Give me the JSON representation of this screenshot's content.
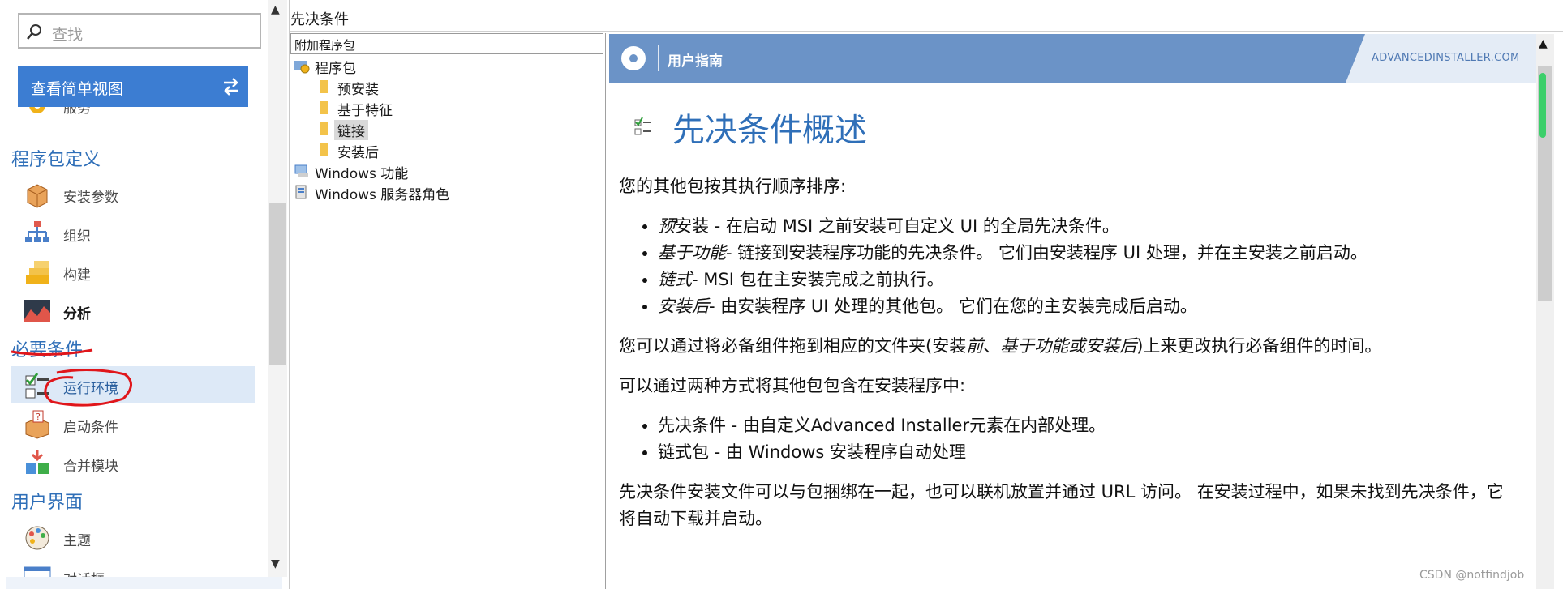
{
  "sidebar": {
    "search_placeholder": "查找",
    "simple_view_label": "查看简单视图",
    "partial_item": "服务",
    "sections": [
      {
        "title": "程序包定义",
        "items": [
          "安装参数",
          "组织",
          "构建",
          "分析"
        ]
      },
      {
        "title": "必要条件",
        "items": [
          "运行环境",
          "启动条件",
          "合并模块"
        ]
      },
      {
        "title": "用户界面",
        "items": [
          "主题",
          "对话框"
        ]
      }
    ]
  },
  "center": {
    "title": "先决条件",
    "tree_header": "附加程序包",
    "tree": {
      "root": "程序包",
      "children": [
        "预安装",
        "基于特征",
        "链接",
        "安装后"
      ],
      "windows_features": "Windows 功能",
      "windows_server_roles": "Windows 服务器角色"
    }
  },
  "doc": {
    "header_guide": "用户指南",
    "header_site": "ADVANCEDINSTALLER.COM",
    "title": "先决条件概述",
    "p1": "您的其他包按其执行顺序排序:",
    "list1": [
      {
        "term": "预",
        "term2": "安装",
        "rest": " - 在启动 MSI 之前安装可自定义 UI 的全局先决条件。"
      },
      {
        "term": "基于功能",
        "rest": "- 链接到安装程序功能的先决条件。 它们由安装程序 UI 处理，并在主安装之前启动。"
      },
      {
        "term": "链式",
        "rest": "- MSI 包在主安装完成之前执行。"
      },
      {
        "term": "安装后",
        "rest": "- 由安装程序 UI 处理的其他包。 它们在您的主安装完成后启动。"
      }
    ],
    "p2_a": "您可以通过将必备组件拖到相应的文件夹(安装",
    "p2_b": "前",
    "p2_c": "、",
    "p2_d": "基于功能或安装后",
    "p2_e": ")上来更改执行必备组件的时间。",
    "p3": "可以通过两种方式将其他包包含在安装程序中:",
    "list2": [
      "先决条件 - 由自定义Advanced Installer元素在内部处理。",
      "链式包 - 由 Windows 安装程序自动处理"
    ],
    "p4": "先决条件安装文件可以与包捆绑在一起，也可以联机放置并通过 URL 访问。 在安装过程中，如果未找到先决条件，它将自动下载并启动。"
  },
  "watermark": "CSDN @notfindjob",
  "colors": {
    "accent": "#3c7dd2",
    "section": "#2f6fb8",
    "header": "#6b93c7",
    "annotation": "#e0161b"
  }
}
